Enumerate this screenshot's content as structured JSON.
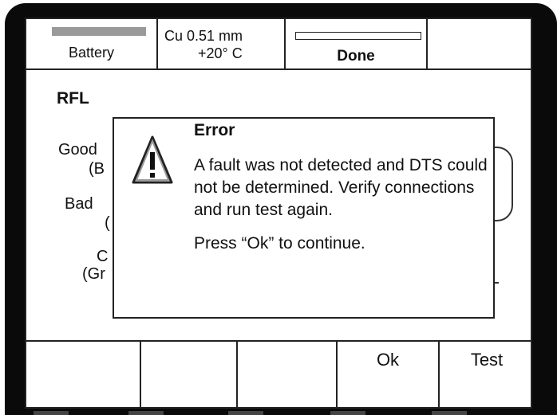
{
  "status_bar": {
    "battery_label": "Battery",
    "battery_level": 1.0,
    "wire_line1": "Cu 0.51 mm",
    "wire_line2": "+20° C",
    "progress_label": "Done",
    "progress_fraction": 0.0
  },
  "screen": {
    "mode_title": "RFL",
    "background_fragments": [
      "Good",
      "(B",
      "Bad",
      "(",
      "C",
      "(Gr"
    ]
  },
  "dialog": {
    "title": "Error",
    "message": "A fault was not detected and DTS could not be determined. Verify connections and run test again.",
    "instruction": "Press “Ok” to continue.",
    "icon": "warning-triangle-icon"
  },
  "softkeys": [
    "",
    "",
    "",
    "Ok",
    "Test"
  ],
  "colors": {
    "bezel": "#0a0a0a",
    "battery_fill": "#9a9a9a",
    "screen": "#ffffff"
  }
}
